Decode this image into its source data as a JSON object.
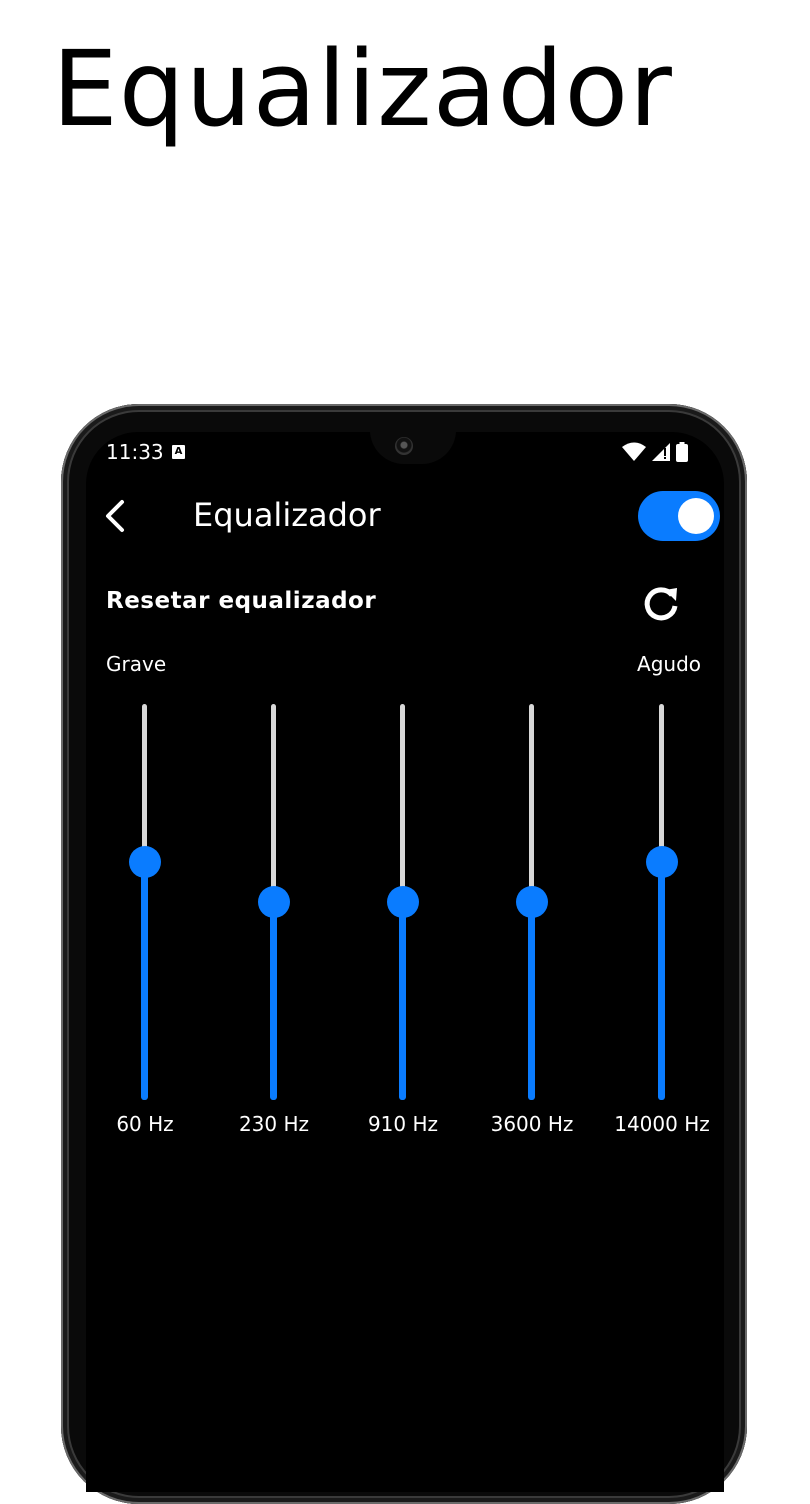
{
  "promo": {
    "title": "Equalizador"
  },
  "status_bar": {
    "time": "11:33",
    "a_icon_letter": "A"
  },
  "header": {
    "title": "Equalizador",
    "enabled": true,
    "accent": "#0a7cff"
  },
  "reset": {
    "label": "Resetar equalizador"
  },
  "range": {
    "low_label": "Grave",
    "high_label": "Agudo"
  },
  "bands": [
    {
      "label": "60 Hz",
      "level": 0.6
    },
    {
      "label": "230 Hz",
      "level": 0.5
    },
    {
      "label": "910 Hz",
      "level": 0.5
    },
    {
      "label": "3600 Hz",
      "level": 0.5
    },
    {
      "label": "14000 Hz",
      "level": 0.6
    }
  ]
}
